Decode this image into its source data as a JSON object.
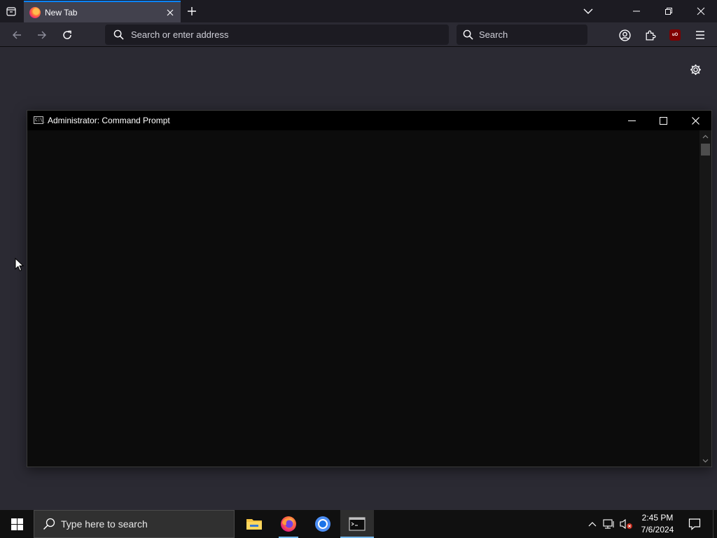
{
  "browser": {
    "tab": {
      "title": "New Tab"
    },
    "urlbar": {
      "placeholder": "Search or enter address"
    },
    "searchbar": {
      "placeholder": "Search"
    },
    "ublock_badge": "uO"
  },
  "cmd_window": {
    "title": "Administrator: Command Prompt",
    "icon_text": "C:\\_"
  },
  "taskbar": {
    "search_placeholder": "Type here to search",
    "clock": {
      "time": "2:45 PM",
      "date": "7/6/2024"
    },
    "apps": [
      "file-explorer",
      "firefox",
      "chrome",
      "command-prompt"
    ]
  },
  "colors": {
    "browser_bg": "#2b2a33",
    "tabstrip_bg": "#1c1b22",
    "active_tab_bg": "#42414d",
    "accent": "#0a84ff",
    "cmd_bg": "#0c0c0c",
    "taskbar_bg": "#101010",
    "taskbar_indicator": "#76b9ed"
  }
}
